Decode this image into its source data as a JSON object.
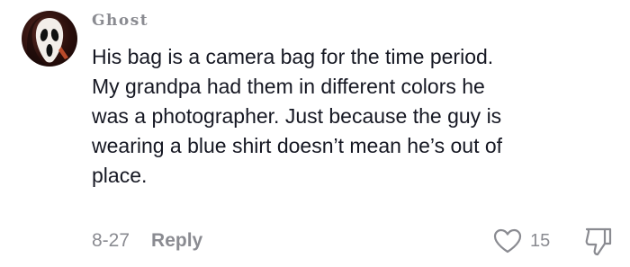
{
  "comment": {
    "avatar_icon": "ghostface-mask-avatar",
    "username": "Ghost",
    "text_lines": [
      "His bag is a camera bag for the time period.",
      "My grandpa had them in different colors he",
      "was a photographer. Just because the guy is",
      "wearing a blue shirt doesn’t mean he’s out of",
      "place."
    ],
    "date": "8-27",
    "reply_label": "Reply",
    "like_icon": "heart-outline-icon",
    "like_count": "15",
    "dislike_icon": "thumbs-down-outline-icon"
  },
  "colors": {
    "text": "#161823",
    "muted": "#8a8b91",
    "background": "#ffffff"
  }
}
